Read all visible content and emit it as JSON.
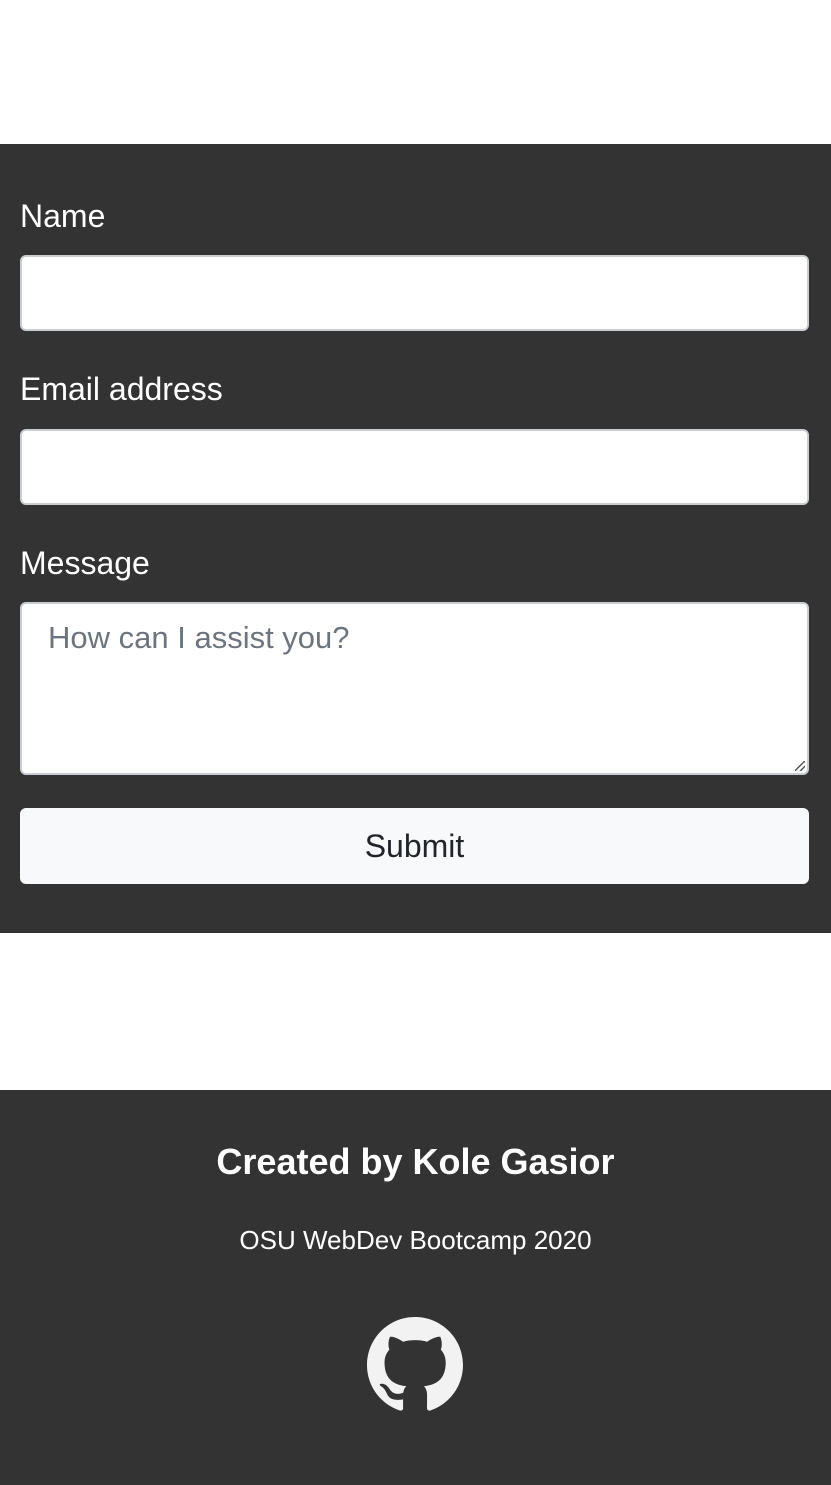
{
  "form": {
    "name_label": "Name",
    "name_value": "",
    "email_label": "Email address",
    "email_value": "",
    "message_label": "Message",
    "message_placeholder": "How can I assist you?",
    "submit_label": "Submit"
  },
  "footer": {
    "title": "Created by Kole Gasior",
    "subtitle": "OSU WebDev Bootcamp 2020",
    "github_icon": "github-icon"
  },
  "colors": {
    "section_bg": "#333333",
    "page_bg": "#ffffff",
    "button_bg": "#f8f9fa",
    "placeholder": "#6c757d"
  }
}
